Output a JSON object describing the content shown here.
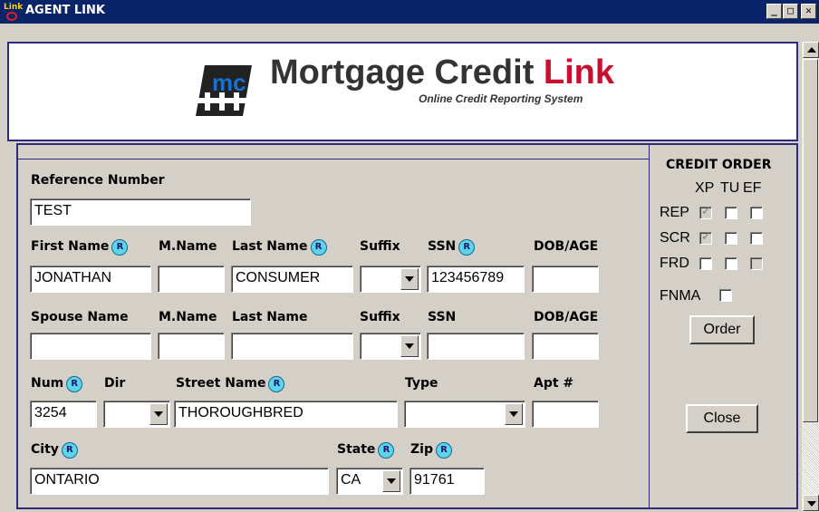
{
  "window": {
    "title": "AGENT LINK",
    "icon_text": "Link",
    "min_label": "_",
    "max_label": "□",
    "close_label": "✕"
  },
  "banner": {
    "brand_prefix": "Mortgage Credit ",
    "brand_accent": "Link",
    "subtitle": "Online Credit Reporting System",
    "logo_mark": "mc"
  },
  "colors": {
    "titlebar": "#0a246a",
    "accent_red": "#c8102e",
    "border_navy": "#2b2b7a",
    "badge": "#5fd3ea"
  },
  "form": {
    "reference_label": "Reference Number",
    "reference_value": "TEST",
    "badge_glyph": "R",
    "row1": {
      "first_name_label": "First Name",
      "mname_label": "M.Name",
      "last_name_label": "Last Name",
      "suffix_label": "Suffix",
      "ssn_label": "SSN",
      "dob_label": "DOB/AGE",
      "first_name": "JONATHAN",
      "mname": "",
      "last_name": "CONSUMER",
      "suffix": "",
      "ssn": "123456789",
      "dob": ""
    },
    "row2": {
      "spouse_label": "Spouse Name",
      "mname_label": "M.Name",
      "last_name_label": "Last Name",
      "suffix_label": "Suffix",
      "ssn_label": "SSN",
      "dob_label": "DOB/AGE",
      "spouse": "",
      "mname": "",
      "last_name": "",
      "suffix": "",
      "ssn": "",
      "dob": ""
    },
    "row3": {
      "num_label": "Num",
      "dir_label": "Dir",
      "street_label": "Street Name",
      "type_label": "Type",
      "apt_label": "Apt #",
      "num": "3254",
      "dir": "",
      "street": "THOROUGHBRED",
      "type": "",
      "apt": ""
    },
    "row4": {
      "city_label": "City",
      "state_label": "State",
      "zip_label": "Zip",
      "city": "ONTARIO",
      "state": "CA",
      "zip": "91761"
    }
  },
  "credit_order": {
    "title": "CREDIT ORDER",
    "bureaus": [
      "XP",
      "TU",
      "EF"
    ],
    "rows": [
      {
        "label": "REP",
        "checks": [
          "checked-disabled",
          "unchecked",
          "unchecked"
        ]
      },
      {
        "label": "SCR",
        "checks": [
          "checked-disabled",
          "unchecked",
          "unchecked"
        ]
      },
      {
        "label": "FRD",
        "checks": [
          "unchecked",
          "unchecked",
          "disabled"
        ]
      }
    ],
    "fnma_label": "FNMA",
    "order_label": "Order",
    "close_label": "Close"
  }
}
